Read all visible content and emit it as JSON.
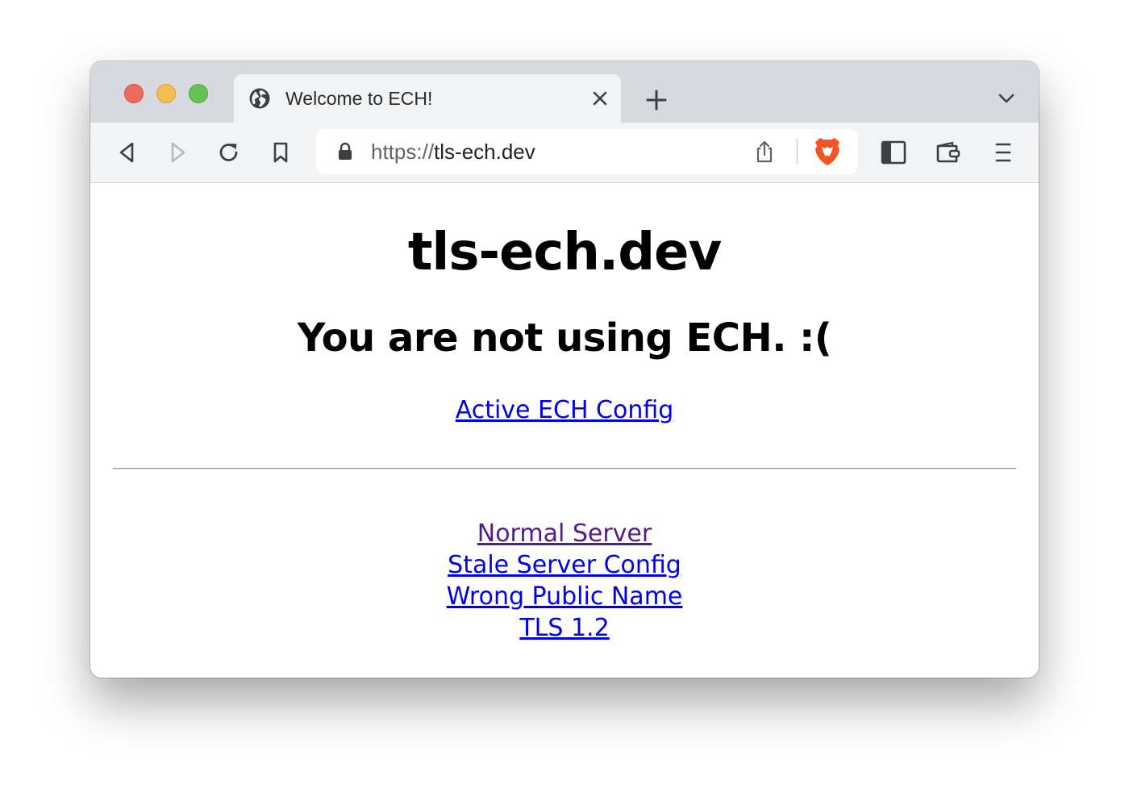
{
  "browser": {
    "tab": {
      "title": "Welcome to ECH!"
    },
    "url": {
      "scheme": "https://",
      "host": "tls-ech.dev"
    }
  },
  "page": {
    "heading": "tls-ech.dev",
    "status": "You are not using ECH. :(",
    "active_config_link": "Active ECH Config",
    "test_links": [
      {
        "label": "Normal Server",
        "visited": true
      },
      {
        "label": "Stale Server Config",
        "visited": false
      },
      {
        "label": "Wrong Public Name",
        "visited": false
      },
      {
        "label": "TLS 1.2",
        "visited": false
      }
    ]
  },
  "colors": {
    "link": "#0000ee",
    "visited_link": "#551a8b",
    "brave_brand": "#f05523",
    "close_red": "#ec6a5f",
    "minimize_yellow": "#f4bf4f",
    "zoom_green": "#61c454"
  },
  "icons": {
    "tab_favicon": "globe-icon",
    "tab_close": "close-icon",
    "new_tab": "plus-icon",
    "tab_menu": "chevron-down-icon",
    "back": "back-icon",
    "forward": "forward-icon",
    "reload": "reload-icon",
    "bookmark": "bookmark-icon",
    "lock": "lock-icon",
    "share": "share-icon",
    "brave_shields": "brave-lion-icon",
    "sidebar": "sidebar-icon",
    "wallet": "wallet-icon",
    "menu": "hamburger-menu-icon"
  }
}
